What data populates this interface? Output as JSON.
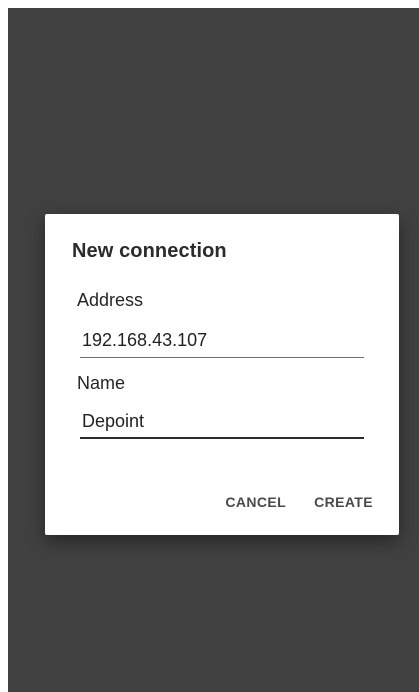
{
  "dialog": {
    "title": "New connection",
    "address": {
      "label": "Address",
      "value": "192.168.43.107"
    },
    "name": {
      "label": "Name",
      "value": "Depoint"
    },
    "actions": {
      "cancel_label": "CANCEL",
      "create_label": "CREATE"
    }
  },
  "colors": {
    "scrim": "#414141",
    "dialog_bg": "#ffffff",
    "text": "#262626",
    "button_text": "#4a4a4a"
  }
}
